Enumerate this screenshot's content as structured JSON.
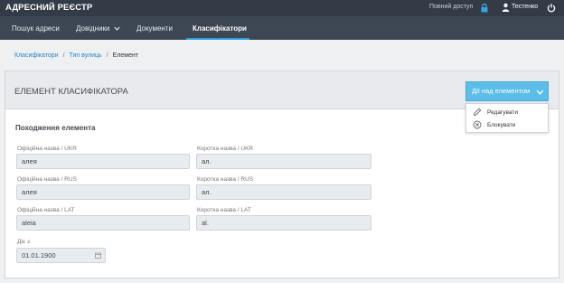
{
  "app": {
    "title": "АДРЕСНИЙ РЕЄСТР",
    "access": "Повний доступ",
    "user": "Тестенко"
  },
  "nav": [
    {
      "label": "Пошук адреси"
    },
    {
      "label": "Довідники",
      "has_dropdown": true
    },
    {
      "label": "Документи"
    },
    {
      "label": "Класифікатори",
      "active": true
    }
  ],
  "breadcrumb": [
    "Класифікатори",
    "Тип вулиць",
    "Елемент"
  ],
  "card": {
    "title": "ЕЛЕМЕНТ КЛАСИФІКАТОРА",
    "actions_label": "Дії над елементом",
    "actions_menu": [
      {
        "label": "Редагувати",
        "icon": "pencil-icon"
      },
      {
        "label": "Блокувати",
        "icon": "block-icon"
      }
    ],
    "section_title": "Походження елемента",
    "fields": {
      "official_ukr": {
        "label": "Офіційна назва / UKR",
        "value": "алея"
      },
      "short_ukr": {
        "label": "Коротка назва / UKR",
        "value": "ал."
      },
      "official_rus": {
        "label": "Офіційна назва / RUS",
        "value": "алея"
      },
      "short_rus": {
        "label": "Коротка назва / RUS",
        "value": "ал."
      },
      "official_lat": {
        "label": "Офіційна назва / LAT",
        "value": "aleia"
      },
      "short_lat": {
        "label": "Коротка назва / LAT",
        "value": "al."
      },
      "valid_from": {
        "label": "Діє з",
        "value": "01.01.1900"
      }
    }
  },
  "colors": {
    "topbar": "#333b46",
    "navbar": "#3d4653",
    "accent": "#2aa0e0",
    "button": "#5bbde8"
  }
}
